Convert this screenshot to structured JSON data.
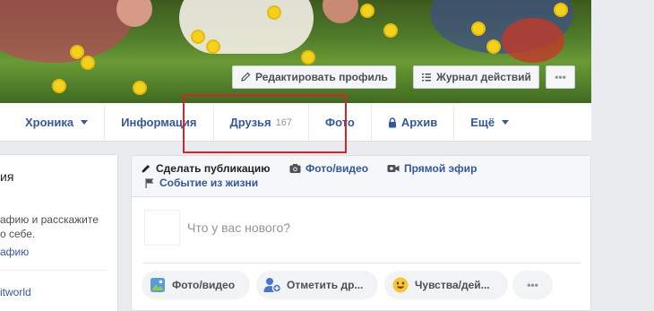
{
  "cover": {
    "edit_profile_label": "Редактировать профиль",
    "activity_log_label": "Журнал действий",
    "more_label": "•••"
  },
  "tabs": [
    {
      "label": "Хроника",
      "has_caret": true
    },
    {
      "label": "Информация"
    },
    {
      "label": "Друзья",
      "count": "167"
    },
    {
      "label": "Фото"
    },
    {
      "label": "Архив",
      "icon": "lock-icon"
    },
    {
      "label": "Ещё",
      "has_caret": true
    }
  ],
  "left": {
    "title_fragment": "ия",
    "text_fragment_1": "афию и расскажите",
    "text_fragment_2": "о себе.",
    "link_fragment": "афию",
    "bottom_fragment": "itworld"
  },
  "composer": {
    "create_post": "Сделать публикацию",
    "photo_video": "Фото/видео",
    "live": "Прямой эфир",
    "life_event": "Событие из жизни",
    "prompt": "Что у вас нового?",
    "actions": {
      "photo_video": "Фото/видео",
      "tag_friends": "Отметить др...",
      "feeling": "Чувства/дей...",
      "more": "•••"
    }
  },
  "colors": {
    "link": "#365899",
    "highlight": "#d0262c",
    "background": "#e9ebee"
  }
}
